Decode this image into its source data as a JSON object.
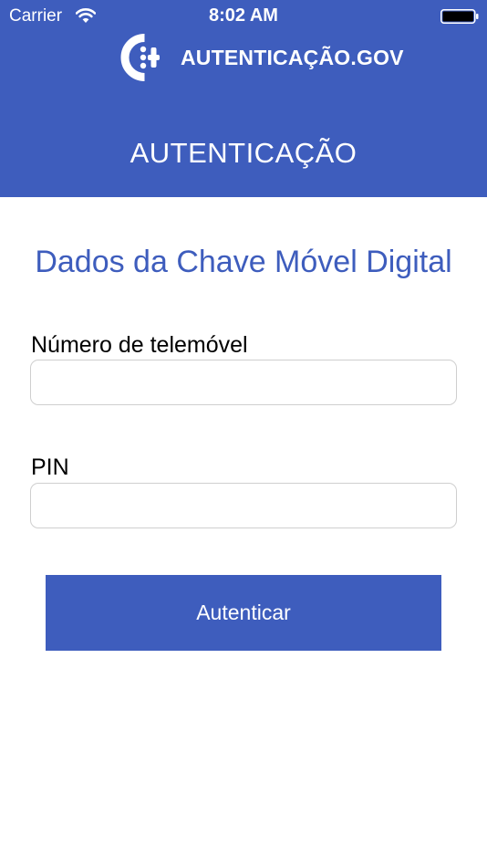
{
  "status_bar": {
    "carrier": "Carrier",
    "time": "8:02 AM"
  },
  "header": {
    "brand": "AUTENTICAÇÃO.GOV",
    "title": "AUTENTICAÇÃO",
    "background_color": "#3e5dbd"
  },
  "form": {
    "title": "Dados da Chave Móvel Digital",
    "phone_label": "Número de telemóvel",
    "phone_value": "",
    "pin_label": "PIN",
    "pin_value": "",
    "submit_label": "Autenticar"
  },
  "colors": {
    "accent": "#3e5dbd",
    "input_border": "#cfcfcf"
  }
}
